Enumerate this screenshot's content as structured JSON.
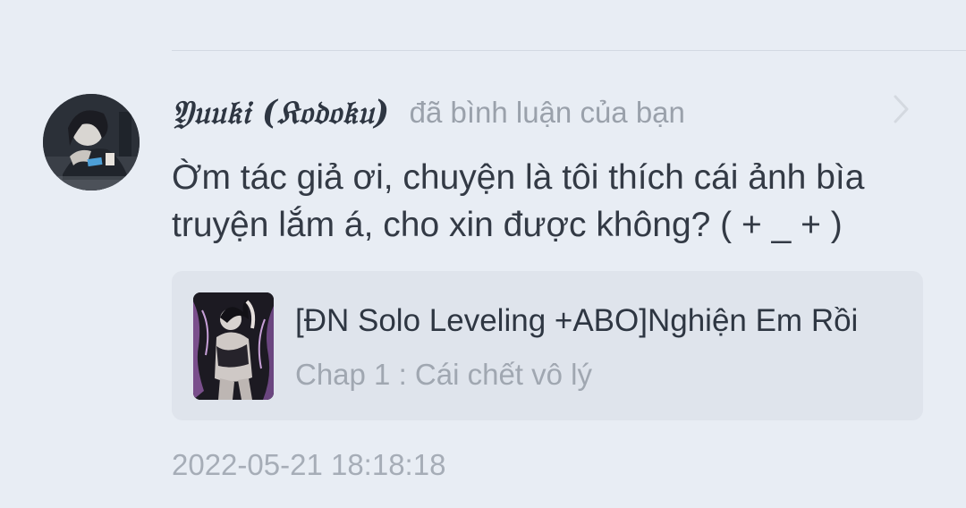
{
  "notification": {
    "username": "𝔜𝔲𝔲𝔨𝔦 (𝔎𝔬𝔡𝔬𝔨𝔲)",
    "action": "đã bình luận của bạn",
    "comment": "Ờm tác giả ơi, chuyện là tôi thích cái ảnh bìa truyện lắm á, cho xin được không? ( + _ + )",
    "avatar_icon": "user-avatar",
    "chevron_icon": "chevron-right-icon",
    "story": {
      "title": "[ĐN Solo Leveling +ABO]Nghiện Em Rồi",
      "chapter": "Chap 1 : Cái chết vô lý",
      "cover_icon": "story-cover-image"
    },
    "timestamp": "2022-05-21 18:18:18"
  },
  "colors": {
    "background": "#e8edf4",
    "card_background": "#dfe4ec",
    "primary_text": "#333a45",
    "secondary_text": "#9aa1ab"
  }
}
